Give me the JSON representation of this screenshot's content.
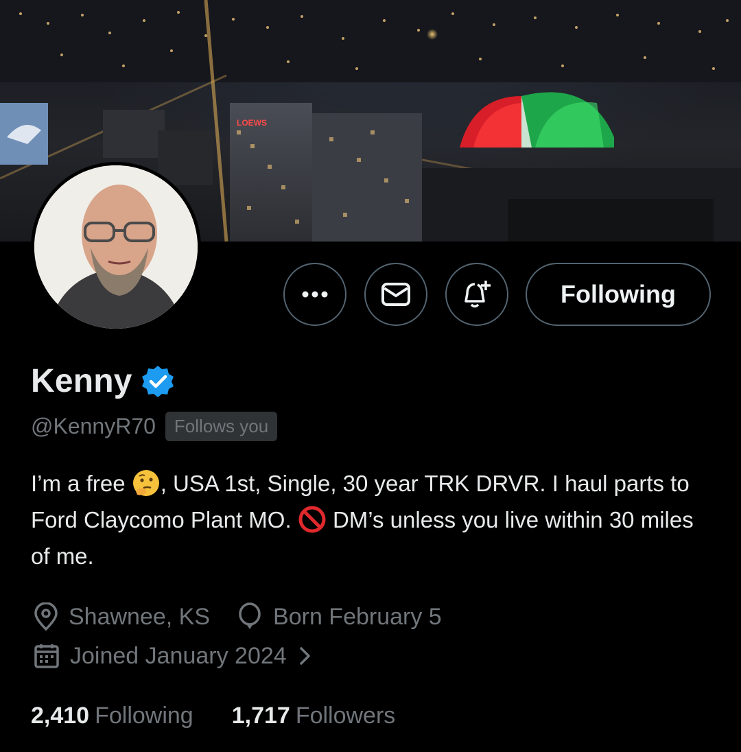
{
  "banner": {
    "sign_text": "LOEWS"
  },
  "actions": {
    "more_icon": "more-icon",
    "message_icon": "envelope-icon",
    "notify_icon": "bell-plus-icon",
    "follow_label": "Following"
  },
  "profile": {
    "name": "Kenny",
    "verified": true,
    "handle": "@KennyR70",
    "follows_you": "Follows you",
    "bio": {
      "part1": "I’m a free ",
      "emoji1": "thinking-face-emoji",
      "part2": ", USA 1st, Single, 30 year TRK DRVR. I haul parts to Ford Claycomo Plant MO. ",
      "emoji2": "prohibited-emoji",
      "part3": " DM’s unless you live within 30 miles of me."
    },
    "location": "Shawnee, KS",
    "birthday": "Born February 5",
    "joined": "Joined January 2024"
  },
  "stats": {
    "following_count": "2,410",
    "following_label": "Following",
    "followers_count": "1,717",
    "followers_label": "Followers"
  },
  "colors": {
    "background": "#000000",
    "text": "#e7e9ea",
    "secondary": "#71767b",
    "border": "#536471",
    "verified": "#1d9bf0"
  }
}
